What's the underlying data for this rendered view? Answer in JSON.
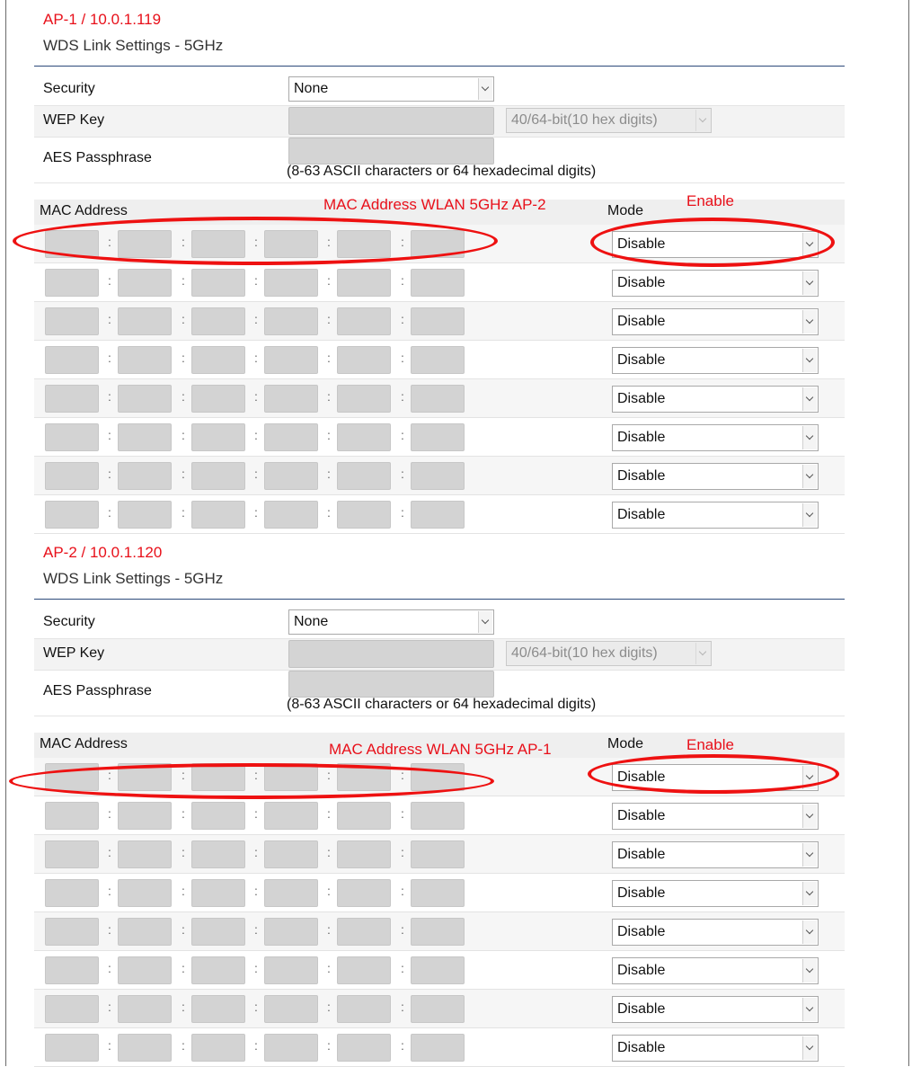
{
  "colors": {
    "accent_red": "#e8101a",
    "field_gray": "#d4d4d4",
    "rule_blue": "#2d4a7a"
  },
  "icons": {
    "select_arrow": "chevron-down-icon"
  },
  "sections": [
    {
      "ap_title": "AP-1 / 10.0.1.119",
      "wds_title": "WDS Link Settings - 5GHz",
      "security_label": "Security",
      "security_value": "None",
      "wep_key_label": "WEP Key",
      "wep_key_length": "40/64-bit(10 hex digits)",
      "aes_label": "AES Passphrase",
      "aes_hint": "(8-63 ASCII characters or 64 hexadecimal digits)",
      "mac_header": "MAC Address",
      "mode_header": "Mode",
      "mac_annotation": "MAC Address WLAN 5GHz AP-2",
      "mode_annotation": "Enable",
      "mac_separator": ":",
      "rows": [
        {
          "mode": "Disable"
        },
        {
          "mode": "Disable"
        },
        {
          "mode": "Disable"
        },
        {
          "mode": "Disable"
        },
        {
          "mode": "Disable"
        },
        {
          "mode": "Disable"
        },
        {
          "mode": "Disable"
        },
        {
          "mode": "Disable"
        }
      ]
    },
    {
      "ap_title": "AP-2 / 10.0.1.120",
      "wds_title": "WDS Link Settings - 5GHz",
      "security_label": "Security",
      "security_value": "None",
      "wep_key_label": "WEP Key",
      "wep_key_length": "40/64-bit(10 hex digits)",
      "aes_label": "AES Passphrase",
      "aes_hint": "(8-63 ASCII characters or 64 hexadecimal digits)",
      "mac_header": "MAC Address",
      "mode_header": "Mode",
      "mac_annotation": "MAC Address WLAN 5GHz AP-1",
      "mode_annotation": "Enable",
      "mac_separator": ":",
      "rows": [
        {
          "mode": "Disable"
        },
        {
          "mode": "Disable"
        },
        {
          "mode": "Disable"
        },
        {
          "mode": "Disable"
        },
        {
          "mode": "Disable"
        },
        {
          "mode": "Disable"
        },
        {
          "mode": "Disable"
        },
        {
          "mode": "Disable"
        }
      ]
    }
  ]
}
